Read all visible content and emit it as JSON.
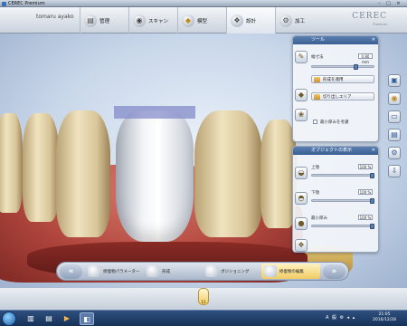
{
  "window": {
    "title": "CEREC Premium",
    "min": "–",
    "max": "□",
    "close": "✕"
  },
  "header": {
    "patient": "tomaru ayako",
    "phases": [
      {
        "label": "管理",
        "icon": "folder-icon"
      },
      {
        "label": "スキャン",
        "icon": "scan-icon"
      },
      {
        "label": "模型",
        "icon": "model-icon"
      },
      {
        "label": "設計",
        "icon": "design-icon",
        "active": true
      },
      {
        "label": "加工",
        "icon": "mill-icon"
      }
    ],
    "logo": "CEREC",
    "logo_sub": "Premium"
  },
  "tools_panel": {
    "title": "ツール",
    "close": "✕",
    "size_label": "幅寸法",
    "size_value": "0.80 mm",
    "size_level": 0.72,
    "btn_apply": "形成を適用",
    "btn_crop": "切り出しエリア",
    "chk_label": "最小厚みを考慮"
  },
  "objects_panel": {
    "title": "オブジェクトの表示",
    "close": "✕",
    "rows": [
      {
        "label": "上顎",
        "value": "100 %",
        "level": 1.0
      },
      {
        "label": "下顎",
        "value": "100 %",
        "level": 1.0
      },
      {
        "label": "最小厚み",
        "value": "100 %",
        "level": 1.0
      }
    ]
  },
  "steps": {
    "prev": "«",
    "next": "»",
    "items": [
      {
        "label": "修復物パラメーター"
      },
      {
        "label": "形成"
      },
      {
        "label": "ポジショニング"
      },
      {
        "label": "修復物の編集",
        "active": true
      }
    ]
  },
  "tooth_strip": {
    "selected": "11"
  },
  "taskbar": {
    "clock_time": "21:05",
    "clock_date": "2016/12/28",
    "tray": "A 般 ⚙ ◂ ▴"
  }
}
